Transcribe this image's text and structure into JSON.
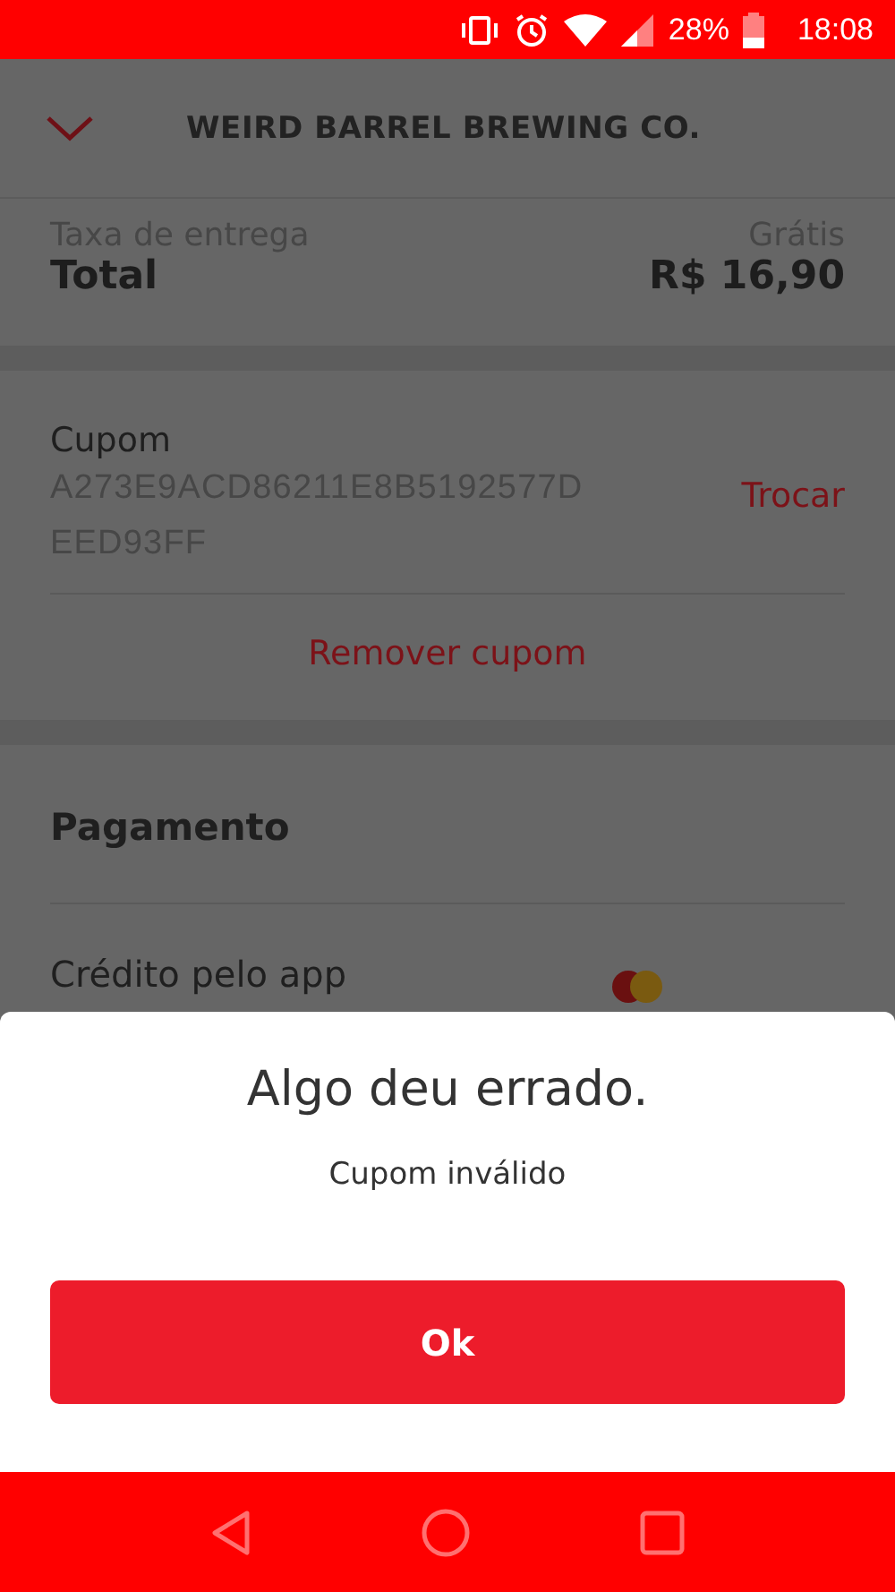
{
  "status_bar": {
    "battery": "28%",
    "time": "18:08"
  },
  "header": {
    "title": "WEIRD BARREL BREWING CO."
  },
  "summary": {
    "rows": [
      {
        "kind": "fee",
        "label": "Taxa de entrega",
        "value": "Grátis"
      },
      {
        "kind": "total",
        "label": "Total",
        "value": "R$ 16,90"
      }
    ]
  },
  "coupon": {
    "title": "Cupom",
    "code": "A273E9ACD86211E8B5192577DEED93FF",
    "change": "Trocar",
    "remove": "Remover cupom"
  },
  "payment": {
    "title": "Pagamento",
    "method": "Crédito pelo app"
  },
  "dialog": {
    "title": "Algo deu errado.",
    "message": "Cupom inválido",
    "button": "Ok"
  }
}
